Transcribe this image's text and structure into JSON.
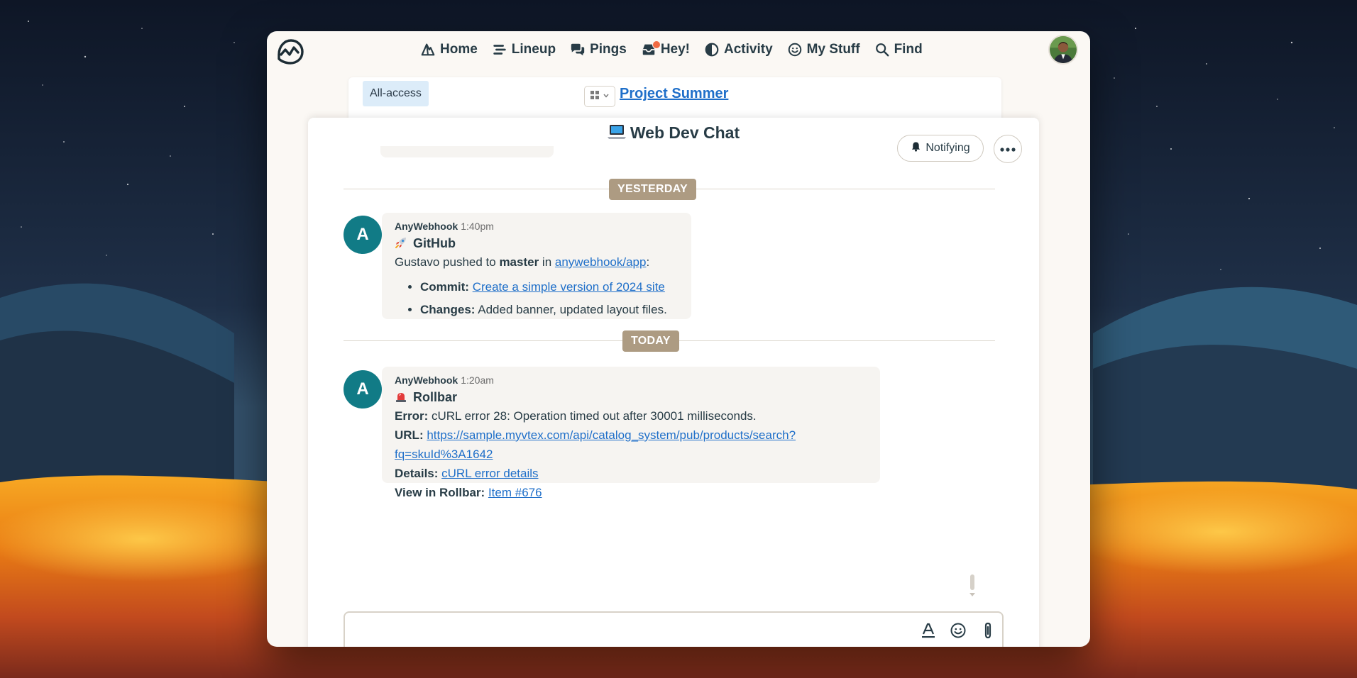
{
  "nav": {
    "items": [
      {
        "label": "Home",
        "icon": "home-icon"
      },
      {
        "label": "Lineup",
        "icon": "lineup-icon"
      },
      {
        "label": "Pings",
        "icon": "pings-icon"
      },
      {
        "label": "Hey!",
        "icon": "hey-icon",
        "has_notification": true
      },
      {
        "label": "Activity",
        "icon": "activity-icon"
      },
      {
        "label": "My Stuff",
        "icon": "my-stuff-icon"
      },
      {
        "label": "Find",
        "icon": "search-icon"
      }
    ]
  },
  "project": {
    "access_badge": "All-access",
    "name": "Project Summer"
  },
  "chat": {
    "title": "Web Dev Chat",
    "title_icon": "laptop-icon",
    "notify_label": "Notifying"
  },
  "days": {
    "yesterday": "YESTERDAY",
    "today": "TODAY"
  },
  "messages": [
    {
      "avatar_letter": "A",
      "author": "AnyWebhook",
      "time": "1:40pm",
      "title": "GitHub",
      "title_icon": "rocket-icon",
      "intro_prefix": "Gustavo pushed to ",
      "intro_branch": "master",
      "intro_mid": " in ",
      "intro_repo": "anywebhook/app",
      "intro_suffix": ":",
      "commit_label": "Commit:",
      "commit_link": "Create a simple version of 2024 site",
      "changes_label": "Changes:",
      "changes_text": "Added banner, updated layout files."
    },
    {
      "avatar_letter": "A",
      "author": "AnyWebhook",
      "time": "1:20am",
      "title": "Rollbar",
      "title_icon": "siren-icon",
      "error_label": "Error:",
      "error_text": "cURL error 28: Operation timed out after 30001 milliseconds.",
      "url_label": "URL:",
      "url_line1": "https://sample.myvtex.com/api/catalog_system/pub/products/search?",
      "url_line2": "fq=skuId%3A1642",
      "details_label": "Details:",
      "details_link": "cURL error details",
      "rollbar_label": "View in Rollbar:",
      "rollbar_link": "Item #676"
    }
  ],
  "composer": {
    "value": "",
    "placeholder": ""
  },
  "colors": {
    "accent_link": "#1f6fc9",
    "avatar_teal": "#117b86",
    "day_badge": "#ad9b82",
    "notification_dot": "#f06a42"
  }
}
